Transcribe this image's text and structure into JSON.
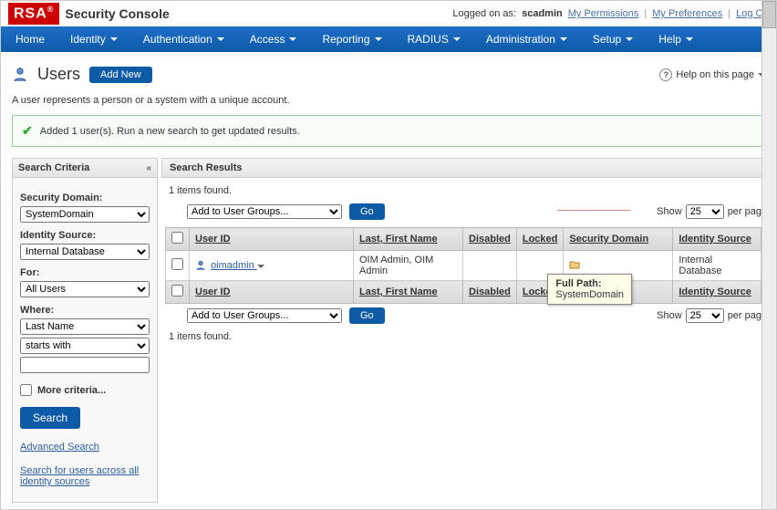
{
  "brand": {
    "logo": "RSA",
    "title": "Security Console"
  },
  "loginbar": {
    "prefix": "Logged on as:",
    "user": "scadmin",
    "perms": "My Permissions",
    "prefs": "My Preferences",
    "logoff": "Log Off"
  },
  "nav": {
    "home": "Home",
    "identity": "Identity",
    "auth": "Authentication",
    "access": "Access",
    "reporting": "Reporting",
    "radius": "RADIUS",
    "admin": "Administration",
    "setup": "Setup",
    "help": "Help"
  },
  "page": {
    "title": "Users",
    "addnew": "Add New",
    "help": "Help on this page",
    "desc": "A user represents a person or a system with a unique account."
  },
  "msg": "Added 1 user(s). Run a new search to get updated results.",
  "sidebar": {
    "title": "Search Criteria",
    "secdom_label": "Security Domain:",
    "secdom_val": "SystemDomain",
    "idsrc_label": "Identity Source:",
    "idsrc_val": "Internal Database",
    "for_label": "For:",
    "for_val": "All Users",
    "where_label": "Where:",
    "where_f1": "Last Name",
    "where_f2": "starts with",
    "more": "More criteria...",
    "search": "Search",
    "adv": "Advanced Search",
    "across": "Search for users across all identity sources"
  },
  "results": {
    "title": "Search Results",
    "found": "1 items found.",
    "action": "Add to User Groups...",
    "go": "Go",
    "show": "Show",
    "perpage": "per pag",
    "ppval": "25",
    "cols": {
      "uid": "User ID",
      "name": "Last, First Name",
      "disabled": "Disabled",
      "locked": "Locked",
      "secdom": "Security Domain",
      "idsrc": "Identity Source"
    },
    "row": {
      "uid": "oimadmin",
      "name": "OIM Admin, OIM Admin",
      "disabled": "",
      "locked": "",
      "idsrc": "Internal Database"
    }
  },
  "tooltip": {
    "label": "Full Path:",
    "value": "SystemDomain"
  }
}
